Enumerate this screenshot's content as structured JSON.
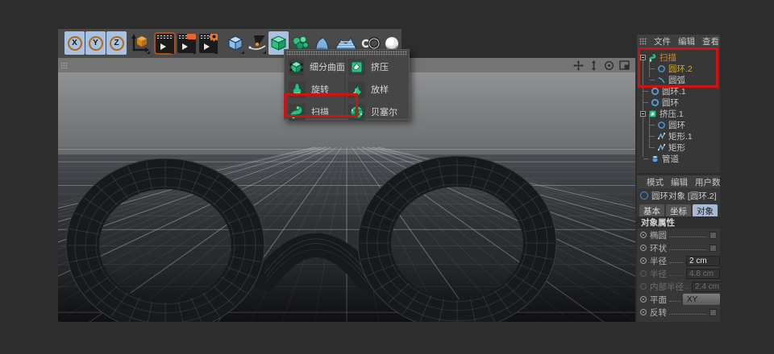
{
  "colors": {
    "annotation_red": "#ce1311",
    "selection_blue": "#a9c2e2",
    "generator_green": "#2fbf7f",
    "spline_blue": "#4a9ad4",
    "selected_text_orange": "#c98a2a"
  },
  "toolbar": {
    "axis_buttons": [
      "X",
      "Y",
      "Z"
    ],
    "icons": [
      "coordinate-system",
      "render-view",
      "render-picture-viewer",
      "render-settings",
      "add-cube-primitive",
      "spline-pen",
      "generators",
      "array",
      "metaball",
      "landscape",
      "symmetry",
      "floor-sky"
    ]
  },
  "generator_menu": {
    "columns": [
      {
        "items": [
          {
            "label": "细分曲面",
            "icon": "subdivision-surface"
          },
          {
            "label": "旋转",
            "icon": "lathe"
          },
          {
            "label": "扫描",
            "icon": "sweep",
            "highlighted": true
          }
        ]
      },
      {
        "items": [
          {
            "label": "挤压",
            "icon": "extrude"
          },
          {
            "label": "放样",
            "icon": "loft"
          },
          {
            "label": "贝塞尔",
            "icon": "bezier"
          }
        ]
      }
    ]
  },
  "viewport": {
    "controls": [
      "pan",
      "zoom",
      "rotate",
      "maximize"
    ]
  },
  "object_manager": {
    "menu": [
      "文件",
      "编辑",
      "查看"
    ],
    "tree": [
      {
        "label": "扫描",
        "icon": "sweep",
        "depth": 0,
        "expanded": true,
        "selected": true
      },
      {
        "label": "圆环.2",
        "icon": "circle",
        "depth": 1,
        "selected": true
      },
      {
        "label": "圆弧",
        "icon": "arc",
        "depth": 1
      },
      {
        "label": "圆环.1",
        "icon": "circle",
        "depth": 0
      },
      {
        "label": "圆环",
        "icon": "circle",
        "depth": 0
      },
      {
        "label": "挤压.1",
        "icon": "extrude",
        "depth": 0,
        "expanded": true
      },
      {
        "label": "圆环",
        "icon": "circle",
        "depth": 1
      },
      {
        "label": "矩形.1",
        "icon": "rect-spline",
        "depth": 1
      },
      {
        "label": "矩形",
        "icon": "rect-spline",
        "depth": 1
      },
      {
        "label": "管道",
        "icon": "tube",
        "depth": 0
      }
    ]
  },
  "attribute_manager": {
    "menu": [
      "模式",
      "编辑",
      "用户数"
    ],
    "object_title": "圆环对象 [圆环.2]",
    "tabs": [
      {
        "label": "基本"
      },
      {
        "label": "坐标"
      },
      {
        "label": "对象",
        "active": true
      }
    ],
    "section": "对象属性",
    "properties": [
      {
        "label": "椭圆",
        "type": "checkbox",
        "checked": false,
        "enabled": true
      },
      {
        "label": "环状",
        "type": "checkbox",
        "checked": false,
        "enabled": true
      },
      {
        "label": "半径",
        "type": "input",
        "value": "2 cm",
        "enabled": true
      },
      {
        "label": "半径",
        "type": "input",
        "value": "4.8 cm",
        "enabled": false
      },
      {
        "label": "内部半径",
        "type": "input",
        "value": "2.4 cm",
        "enabled": false
      },
      {
        "label": "平面",
        "type": "dropdown",
        "value": "XY",
        "enabled": true
      },
      {
        "label": "反转",
        "type": "checkbox",
        "checked": false,
        "enabled": true
      }
    ]
  }
}
